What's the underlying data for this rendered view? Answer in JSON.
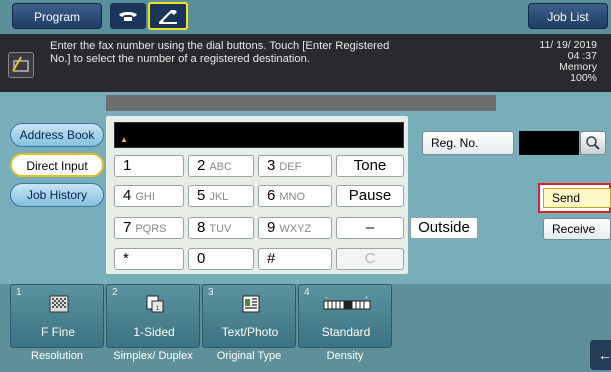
{
  "topbar": {
    "program_label": "Program",
    "joblist_label": "Job List",
    "icons": [
      "telephone-icon",
      "onhook-handset-icon"
    ]
  },
  "message": {
    "line1": "Enter the fax number using the dial buttons. Touch [Enter Registered",
    "line2": "No.] to select the number of a registered destination.",
    "date": "11/ 19/ 2019",
    "time": "04 :37",
    "memory_label": "Memory",
    "memory_value": "100%"
  },
  "menu": {
    "address_book": "Address Book",
    "direct_input": "Direct Input",
    "job_history": "Job History"
  },
  "fax_input": {
    "value": ""
  },
  "keypad": {
    "k1": "1",
    "k2": "2",
    "k2_sub": "ABC",
    "k3": "3",
    "k3_sub": "DEF",
    "tone": "Tone",
    "k4": "4",
    "k4_sub": "GHI",
    "k5": "5",
    "k5_sub": "JKL",
    "k6": "6",
    "k6_sub": "MNO",
    "pause": "Pause",
    "k7": "7",
    "k7_sub": "PQRS",
    "k8": "8",
    "k8_sub": "TUV",
    "k9": "9",
    "k9_sub": "WXYZ",
    "dash": "–",
    "outside": "Outside",
    "star": "*",
    "k0": "0",
    "hash": "#",
    "clear": "C"
  },
  "right_panel": {
    "reg_no_label": "Reg. No.",
    "reg_no_value": "",
    "send_label": "Send",
    "receive_label": "Receive"
  },
  "settings": [
    {
      "num": "1",
      "value": "F Fine",
      "label": "Resolution"
    },
    {
      "num": "2",
      "value": "1-Sided",
      "label": "Simplex/ Duplex"
    },
    {
      "num": "3",
      "value": "Text/Photo",
      "label": "Original Type"
    },
    {
      "num": "4",
      "value": "Standard",
      "label": "Density"
    }
  ],
  "colors": {
    "highlight_yellow": "#f2e21a",
    "send_outline_red": "#e0202a",
    "panel_teal": "#77aeb9"
  }
}
